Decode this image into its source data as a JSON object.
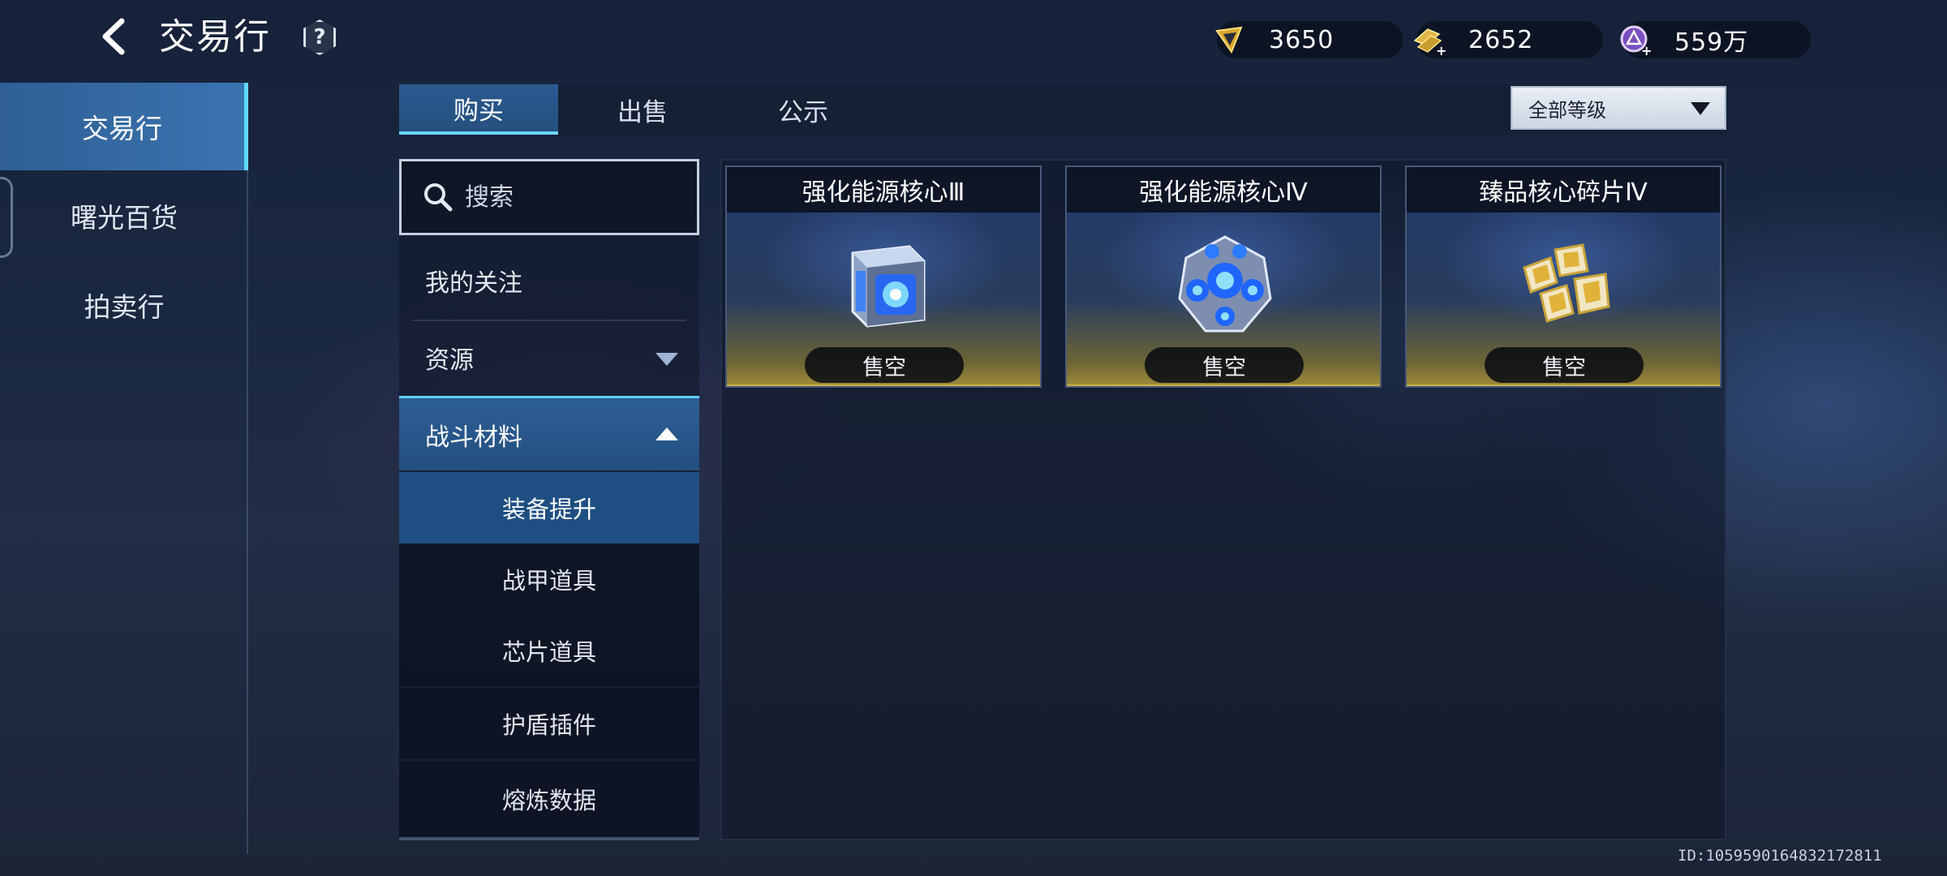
{
  "header": {
    "title": "交易行",
    "help_symbol": "?",
    "currencies": [
      {
        "icon": "shard-token-icon",
        "value": "3650"
      },
      {
        "icon": "gold-bars-add-icon",
        "value": "2652"
      },
      {
        "icon": "purple-coin-add-icon",
        "value": "559万"
      }
    ]
  },
  "sidebar": {
    "items": [
      {
        "label": "交易行",
        "active": true
      },
      {
        "label": "曙光百货",
        "active": false
      },
      {
        "label": "拍卖行",
        "active": false
      }
    ]
  },
  "tabs": [
    {
      "label": "购买",
      "active": true
    },
    {
      "label": "出售",
      "active": false
    },
    {
      "label": "公示",
      "active": false
    }
  ],
  "level_filter": {
    "selected": "全部等级"
  },
  "search": {
    "placeholder": "搜索"
  },
  "categories": {
    "favorites": "我的关注",
    "resources": "资源",
    "combat_materials": "战斗材料",
    "sub_items": [
      {
        "label": "装备提升",
        "active": true
      },
      {
        "label": "战甲道具",
        "active": false
      },
      {
        "label": "芯片道具",
        "active": false
      },
      {
        "label": "护盾插件",
        "active": false
      },
      {
        "label": "熔炼数据",
        "active": false
      }
    ]
  },
  "items": [
    {
      "name": "强化能源核心Ⅲ",
      "status": "售空",
      "icon": "energy-core-cube-icon"
    },
    {
      "name": "强化能源核心Ⅳ",
      "status": "售空",
      "icon": "energy-core-sphere-icon"
    },
    {
      "name": "臻品核心碎片Ⅳ",
      "status": "售空",
      "icon": "core-fragment-icon"
    }
  ],
  "footer": {
    "uid": "ID:1059590164832172811"
  },
  "colors": {
    "accent": "#5ed8ff",
    "active_bg": "#2f5f96",
    "gold": "#c9b24a"
  }
}
